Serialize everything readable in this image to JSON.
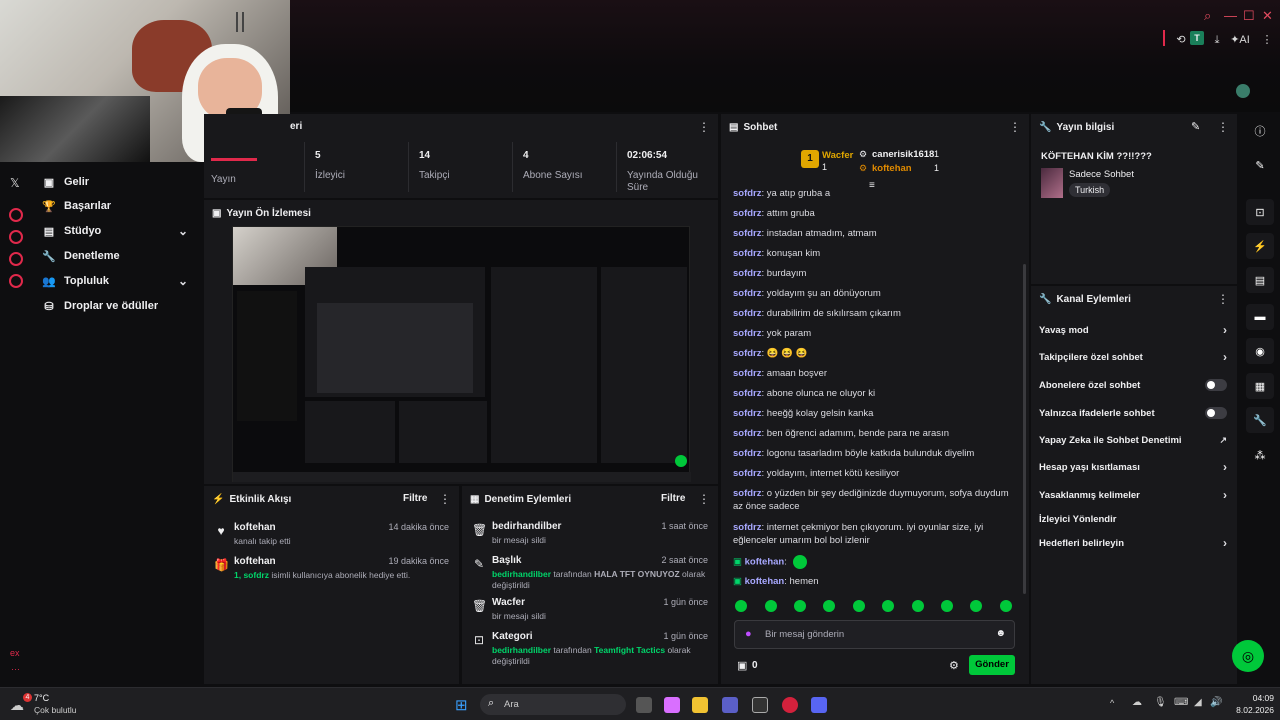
{
  "browser": {
    "ai_label": "AI",
    "avatar_letter": "T"
  },
  "sidebar": {
    "items": [
      {
        "label": "Gelir",
        "icon": "money-icon"
      },
      {
        "label": "Başarılar",
        "icon": "trophy-icon"
      },
      {
        "label": "Stüdyo",
        "icon": "studio-icon"
      },
      {
        "label": "Denetleme",
        "icon": "wrench-icon"
      },
      {
        "label": "Topluluk",
        "icon": "people-icon"
      },
      {
        "label": "Droplar ve ödüller",
        "icon": "drops-icon"
      }
    ],
    "bottom_label": "ex"
  },
  "stats": {
    "partial_title": "eri",
    "live_label": "Yayın",
    "items": [
      {
        "value": "5",
        "label": "İzleyici"
      },
      {
        "value": "14",
        "label": "Takipçi"
      },
      {
        "value": "4",
        "label": "Abone Sayısı"
      },
      {
        "value": "02:06:54",
        "label": "Yayında Olduğu Süre"
      }
    ]
  },
  "preview": {
    "title": "Yayın Ön İzlemesi"
  },
  "activity": {
    "title": "Etkinlik Akışı",
    "filter": "Filtre",
    "items": [
      {
        "name": "koftehan",
        "time": "14 dakika önce",
        "desc": "kanalı takip etti"
      },
      {
        "name": "koftehan",
        "time": "19 dakika önce",
        "desc_green": "1, sofdrz",
        "desc": "isimli kullanıcıya abonelik hediye etti."
      }
    ]
  },
  "moderation": {
    "title": "Denetim Eylemleri",
    "filter": "Filtre",
    "items": [
      {
        "name": "bedirhandilber",
        "time": "1 saat önce",
        "desc": "bir mesajı sildi"
      },
      {
        "name": "Başlık",
        "time": "2 saat önce",
        "g1": "bedirhandilber",
        "mid": " tarafından ",
        "g2": "HALA TFT OYNUYOZ",
        "desc": " olarak değiştirildi"
      },
      {
        "name": "Wacfer",
        "time": "1 gün önce",
        "desc": "bir mesajı sildi"
      },
      {
        "name": "Kategori",
        "time": "1 gün önce",
        "g1": "bedirhandilber",
        "mid": " tarafından ",
        "g2": "Teamfight Tactics",
        "desc": " olarak değiştirildi"
      }
    ]
  },
  "chat": {
    "title": "Sohbet",
    "top": {
      "rank": "1",
      "u1": "Wacfer",
      "c1": "1",
      "u2": "canerisik1618",
      "c2": "1",
      "u3": "koftehan",
      "c3": "1"
    },
    "messages": [
      {
        "user": "sofdrz",
        "text": "ya atıp gruba a"
      },
      {
        "user": "sofdrz",
        "text": "attım gruba"
      },
      {
        "user": "sofdrz",
        "text": "instadan atmadım, atmam"
      },
      {
        "user": "sofdrz",
        "text": "konuşan kim"
      },
      {
        "user": "sofdrz",
        "text": "burdayım"
      },
      {
        "user": "sofdrz",
        "text": "yoldayım şu an dönüyorum"
      },
      {
        "user": "sofdrz",
        "text": "durabilirim de sıkılırsam çıkarım"
      },
      {
        "user": "sofdrz",
        "text": "yok param"
      },
      {
        "user": "sofdrz",
        "text": "😆 😆 😆"
      },
      {
        "user": "sofdrz",
        "text": "amaan boşver"
      },
      {
        "user": "sofdrz",
        "text": "abone olunca ne oluyor ki"
      },
      {
        "user": "sofdrz",
        "text": "heeğğ kolay gelsin kanka"
      },
      {
        "user": "sofdrz",
        "text": "ben öğrenci adamım, bende para ne arasın"
      },
      {
        "user": "sofdrz",
        "text": "logonu tasarladım böyle katkıda bulunduk diyelim"
      },
      {
        "user": "sofdrz",
        "text": "yoldayım, internet kötü kesiliyor"
      },
      {
        "user": "sofdrz",
        "text": "o yüzden bir şey dediğinizde duymuyorum, sofya duydum az önce sadece"
      },
      {
        "user": "sofdrz",
        "text": "internet çekmiyor ben çıkıyorum. iyi oyunlar size, iyi eğlenceler umarım bol bol izlenir"
      },
      {
        "user": "koftehan",
        "text": ""
      },
      {
        "user": "koftehan",
        "text": "hemen"
      }
    ],
    "input_placeholder": "Bir mesaj gönderin",
    "points": "0",
    "send": "Gönder"
  },
  "info": {
    "title": "Yayın bilgisi",
    "stream_title": "KÖFTEHAN KİM ??!!???",
    "category": "Sadece Sohbet",
    "tag": "Turkish"
  },
  "channel_actions": {
    "title": "Kanal Eylemleri",
    "items": [
      {
        "label": "Yavaş mod",
        "type": "chevron"
      },
      {
        "label": "Takipçilere özel sohbet",
        "type": "chevron"
      },
      {
        "label": "Abonelere özel sohbet",
        "type": "toggle"
      },
      {
        "label": "Yalnızca ifadelerle sohbet",
        "type": "toggle"
      },
      {
        "label": "Yapay Zeka ile Sohbet Denetimi",
        "type": "external"
      },
      {
        "label": "Hesap yaşı kısıtlaması",
        "type": "chevron"
      },
      {
        "label": "Yasaklanmış kelimeler",
        "type": "chevron"
      },
      {
        "label": "İzleyici Yönlendir",
        "type": "none"
      },
      {
        "label": "Hedefleri belirleyin",
        "type": "chevron"
      }
    ]
  },
  "taskbar": {
    "weather_temp": "7°C",
    "weather_desc": "Çok bulutlu",
    "search": "Ara",
    "time": "04:09",
    "date": "8.02.2026",
    "badge": "4"
  }
}
